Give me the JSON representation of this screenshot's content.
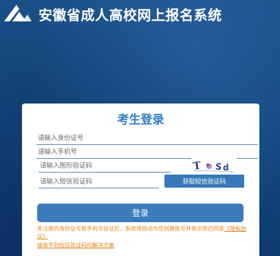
{
  "header": {
    "title": "安徽省成人高校网上报名系统",
    "logo_icon": "triangle-logo-icon"
  },
  "login": {
    "title": "考生登录",
    "id_placeholder": "请输入身份证号",
    "phone_placeholder": "请输入手机号",
    "captcha_placeholder": "请输入图形验证码",
    "captcha_text": "T  Sd",
    "sms_placeholder": "请输入短信验证码",
    "sms_button": "获取短信验证码",
    "login_button": "登录",
    "notice": "未注册的身份证号和手机号验证后，系统将自动为您创建账号并表示您已同意",
    "agreement_link": "《隐私协议》",
    "help_link": "接收不到短信验证码的解决方案"
  },
  "colors": {
    "background": "#14467e",
    "accent": "#2e7fc8",
    "button": "#3b7cbc",
    "notice": "#e0861c"
  }
}
